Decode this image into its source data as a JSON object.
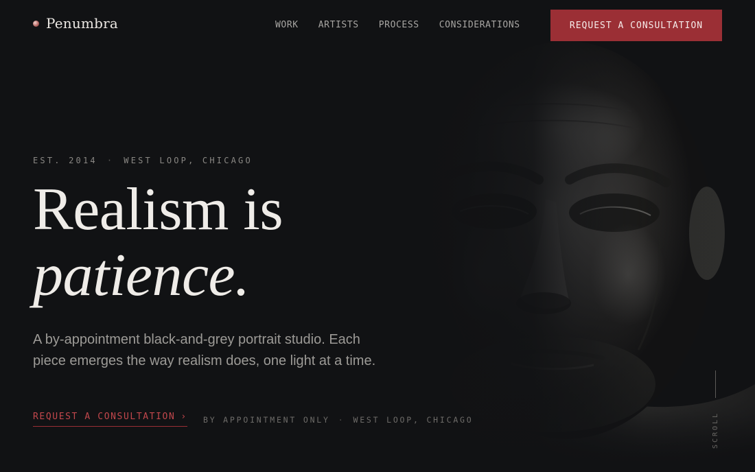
{
  "brand": {
    "name": "Penumbra",
    "icon": "brand-dot-icon"
  },
  "nav": {
    "links": [
      "WORK",
      "ARTISTS",
      "PROCESS",
      "CONSIDERATIONS"
    ],
    "cta_label": "REQUEST A CONSULTATION"
  },
  "hero": {
    "eyebrow_est": "EST. 2014",
    "eyebrow_sep": "·",
    "eyebrow_location": "WEST LOOP, CHICAGO",
    "headline_line1": "Realism is",
    "headline_line2": "patience.",
    "lead": "A by-appointment black-and-grey portrait studio. Each piece emerges the way realism does, one light at a time.",
    "cta_label": "REQUEST A CONSULTATION",
    "cta_arrow": "›",
    "meta_part1": "BY APPOINTMENT ONLY",
    "meta_sep": "·",
    "meta_part2": "WEST LOOP, CHICAGO",
    "scroll_label": "SCROLL"
  },
  "colors": {
    "background": "#111214",
    "accent": "#9b2f35",
    "accent_text": "#c2474c",
    "headline": "#efece8",
    "muted": "#9d9b97"
  },
  "portrait": {
    "icon": "portrait-face-image"
  }
}
